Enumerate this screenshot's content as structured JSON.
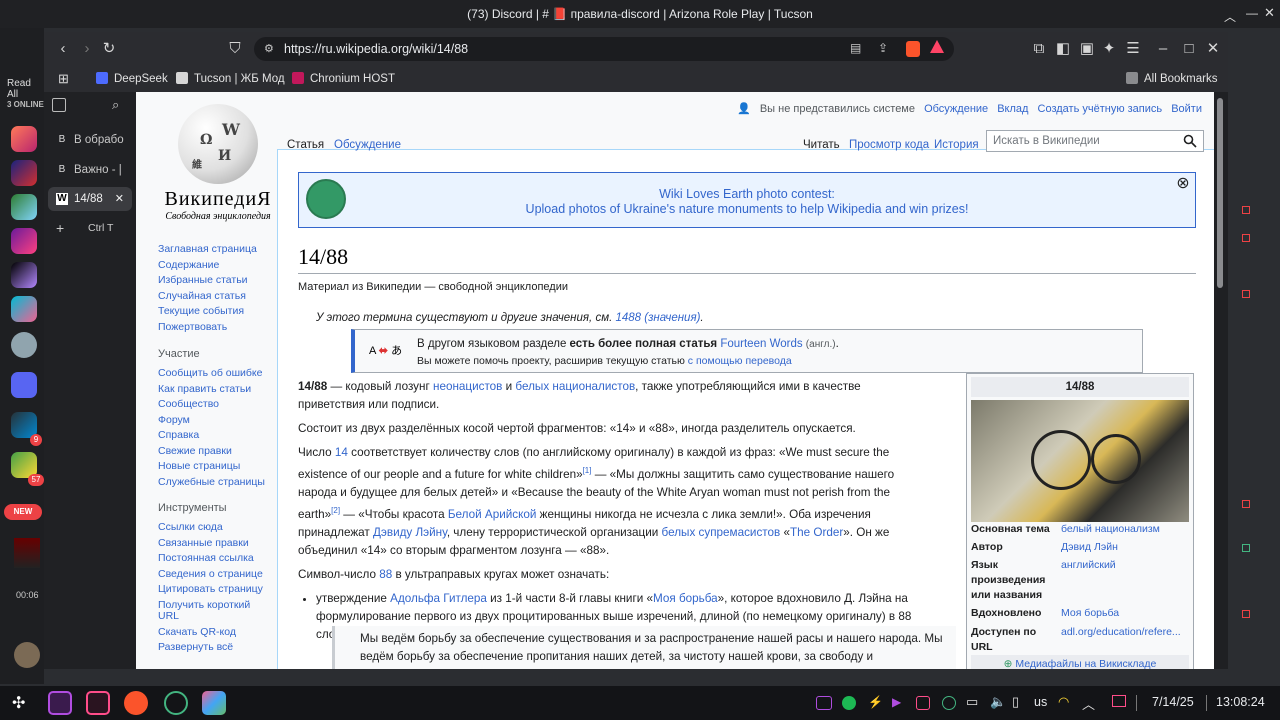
{
  "window": {
    "title": "(73) Discord | # 📕 правила-discord | Arizona Role Play | Tucson"
  },
  "desktop": {
    "left_labels": [
      "Read All",
      "3 ONLINE"
    ],
    "new_badge": "NEW",
    "time_small": "00:06",
    "badges": [
      "9",
      "57"
    ]
  },
  "toolbar": {
    "url": "https://ru.wikipedia.org/wiki/14/88"
  },
  "bookmarks": {
    "items": [
      {
        "label": "DeepSeek",
        "color": "#4d6bfe"
      },
      {
        "label": "Tucson | ЖБ Мод",
        "color": "#d6d6d6"
      },
      {
        "label": "Chronium HOST",
        "color": "#c2185b"
      }
    ],
    "all": "All Bookmarks"
  },
  "vtabs": {
    "items": [
      {
        "label": "В обрабо",
        "icon": "B"
      },
      {
        "label": "Важно - |",
        "icon": "B"
      },
      {
        "label": "14/88",
        "icon": "W"
      }
    ],
    "new_tab_shortcut": "Ctrl T"
  },
  "wiki": {
    "logo": {
      "word": "ВикипедиЯ",
      "tagline": "Свободная энциклопедия"
    },
    "user_menu": {
      "not_logged": "Вы не представились системе",
      "items": [
        "Обсуждение",
        "Вклад",
        "Создать учётную запись",
        "Войти"
      ]
    },
    "tabs": {
      "left": [
        "Статья",
        "Обсуждение"
      ],
      "right": [
        "Читать",
        "Просмотр кода",
        "История"
      ]
    },
    "search_placeholder": "Искать в Википедии",
    "sidebar": {
      "main": [
        "Заглавная страница",
        "Содержание",
        "Избранные статьи",
        "Случайная статья",
        "Текущие события",
        "Пожертвовать"
      ],
      "participation_head": "Участие",
      "participation": [
        "Сообщить об ошибке",
        "Как править статьи",
        "Сообщество",
        "Форум",
        "Справка",
        "Свежие правки",
        "Новые страницы",
        "Служебные страницы"
      ],
      "tools_head": "Инструменты",
      "tools": [
        "Ссылки сюда",
        "Связанные правки",
        "Постоянная ссылка",
        "Сведения о странице",
        "Цитировать страницу",
        "Получить короткий URL",
        "Скачать QR-код",
        "Развернуть всё"
      ]
    },
    "banner": {
      "line1": "Wiki Loves Earth photo contest:",
      "line2": "Upload photos of Ukraine's nature monuments to help Wikipedia and win prizes!"
    },
    "title": "14/88",
    "subtitle": "Материал из Википедии — свободной энциклопедии",
    "hatnote": {
      "text": "У этого термина существуют и другие значения, см. ",
      "link": "1488 (значения)",
      "end": "."
    },
    "langbox": {
      "icon": "A",
      "icon2": "あ",
      "t1": "В другом языковом разделе ",
      "t2": "есть более полная статья",
      "link": "Fourteen Words",
      "small": "(англ.)",
      "t3": ".",
      "t4": "Вы можете помочь проекту, расширив текущую статью ",
      "link2": "с помощью перевода"
    },
    "p1": {
      "bold": "14/88",
      "a": " — кодовый лозунг ",
      "l1": "неонацистов",
      "b": " и ",
      "l2": "белых националистов",
      "c": ", также употребляющийся ими в качестве приветствия или подписи."
    },
    "p2": "Состоит из двух разделённых косой чертой фрагментов: «14» и «88», иногда разделитель опускается.",
    "p3": {
      "a": "Число ",
      "l1": "14",
      "b": " соответствует количеству слов (по английскому оригиналу) в каждой из фраз: «We must secure the existence of our people and a future for white children»",
      "ref1": "[1]",
      "c": " — «Мы должны защитить само существование нашего народа и будущее для белых детей» и «Because the beauty of the White Aryan woman must not perish from the earth»",
      "ref2": "[2]",
      "d": " — «Чтобы красота ",
      "l2": "Белой Арийской",
      "e": " женщины никогда не исчезла с лика земли!». Оба изречения принадлежат ",
      "l3": "Дэвиду Лэйну",
      "f": ", члену террористической организации ",
      "l4": "белых супремасистов",
      "g": " «",
      "l5": "The Order",
      "h": "». Он же объединил «14» со вторым фрагментом лозунга — «88»."
    },
    "p4": {
      "a": "Символ-число ",
      "l1": "88",
      "b": " в ультраправых кругах может означать:"
    },
    "li1": {
      "a": "утверждение ",
      "l1": "Адольфа Гитлера",
      "b": " из 1-й части 8-й главы книги «",
      "l2": "Моя борьба",
      "c": "», которое вдохновило Д. Лэйна на формулирование первого из двух процитированных выше изречений, длиной (по немецкому оригиналу) в 88 слов — перевод:"
    },
    "quote": "Мы ведём борьбу за обеспечение существования и за распространение нашей расы и нашего народа. Мы ведём борьбу за обеспечение пропитания наших детей, за чистоту нашей крови, за свободу и",
    "infobox": {
      "title": "14/88",
      "rows": [
        {
          "k": "Основная тема",
          "v": "белый национализм"
        },
        {
          "k": "Автор",
          "v": "Дэвид Лэйн"
        },
        {
          "k": "Язык произведения или названия",
          "v": "английский"
        },
        {
          "k": "Вдохновлено",
          "v": "Моя борьба"
        },
        {
          "k": "Доступен по URL",
          "v": "adl.org/education/refere..."
        }
      ],
      "media": "Медиафайлы на Викискладе"
    }
  },
  "taskbar": {
    "keyboard": "us",
    "date": "7/14/25",
    "time": "13:08:24"
  }
}
